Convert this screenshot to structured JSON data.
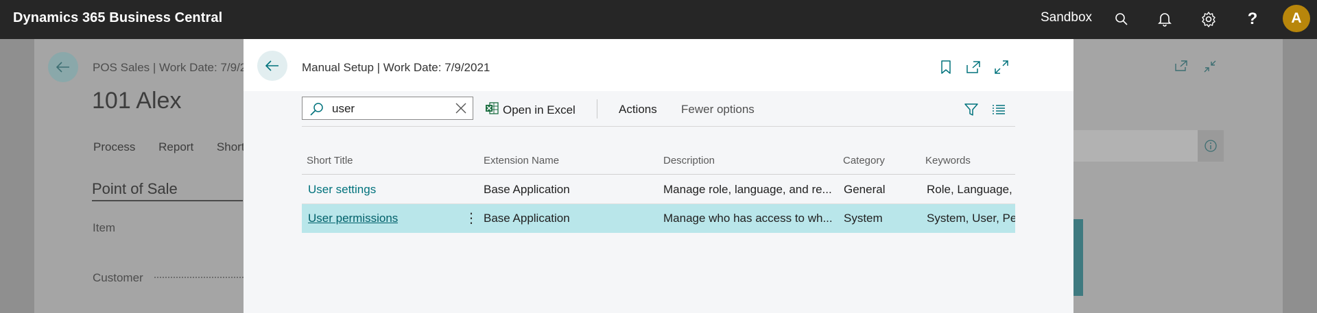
{
  "app": {
    "title": "Dynamics 365 Business Central",
    "environment": "Sandbox",
    "avatar_initial": "A",
    "accent_color": "#00727c",
    "icons": [
      "search-icon",
      "bell-icon",
      "gear-icon",
      "help-icon"
    ]
  },
  "background_page": {
    "subtitle": "POS Sales | Work Date: 7/9/2",
    "title": "101 Alex",
    "actions": [
      "Process",
      "Report",
      "Short"
    ],
    "section": "Point of Sale",
    "fields": [
      "Item",
      "Customer"
    ]
  },
  "modal": {
    "title": "Manual Setup | Work Date: 7/9/2021",
    "toolbar": {
      "search_value": "user",
      "open_in_excel": "Open in Excel",
      "actions": "Actions",
      "fewer_options": "Fewer options"
    },
    "table": {
      "columns": [
        "Short Title",
        "Extension Name",
        "Description",
        "Category",
        "Keywords"
      ],
      "rows": [
        {
          "short_title": "User settings",
          "extension": "Base Application",
          "description": "Manage role, language, and re...",
          "category": "General",
          "keywords": "Role, Language, R"
        },
        {
          "short_title": "User permissions",
          "extension": "Base Application",
          "description": "Manage who has access to wh...",
          "category": "System",
          "keywords": "System, User, Perm"
        }
      ]
    }
  }
}
